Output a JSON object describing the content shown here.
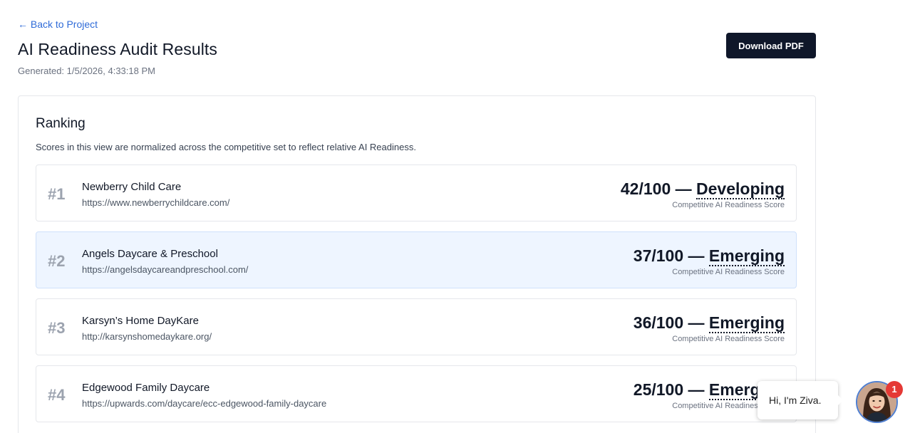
{
  "nav": {
    "back_label": "← Back to Project"
  },
  "header": {
    "title": "AI Readiness Audit Results",
    "generated": "Generated: 1/5/2026, 4:33:18 PM",
    "download_label": "Download PDF"
  },
  "ranking": {
    "title": "Ranking",
    "description": "Scores in this view are normalized across the competitive set to reflect relative AI Readiness.",
    "rows": [
      {
        "rank": "#1",
        "name": "Newberry Child Care",
        "url": "https://www.newberrychildcare.com/",
        "score": "42/100 —",
        "level": "Developing",
        "caption": "Competitive AI Readiness Score"
      },
      {
        "rank": "#2",
        "name": "Angels Daycare & Preschool",
        "url": "https://angelsdaycareandpreschool.com/",
        "score": "37/100 —",
        "level": "Emerging",
        "caption": "Competitive AI Readiness Score"
      },
      {
        "rank": "#3",
        "name": "Karsyn’s Home DayKare",
        "url": "http://karsynshomedaykare.org/",
        "score": "36/100 —",
        "level": "Emerging",
        "caption": "Competitive AI Readiness Score"
      },
      {
        "rank": "#4",
        "name": "Edgewood Family Daycare",
        "url": "https://upwards.com/daycare/ecc-edgewood-family-daycare",
        "score": "25/100 —",
        "level": "Emerging",
        "caption": "Competitive AI Readiness Score"
      }
    ]
  },
  "chat": {
    "greeting": "Hi, I'm Ziva.",
    "badge_count": "1",
    "avatar_icon": "agent-avatar-icon"
  },
  "colors": {
    "link": "#2f6bd8",
    "button": "#0f172a",
    "highlight_row": "#eef5ff",
    "badge": "#e53935"
  }
}
